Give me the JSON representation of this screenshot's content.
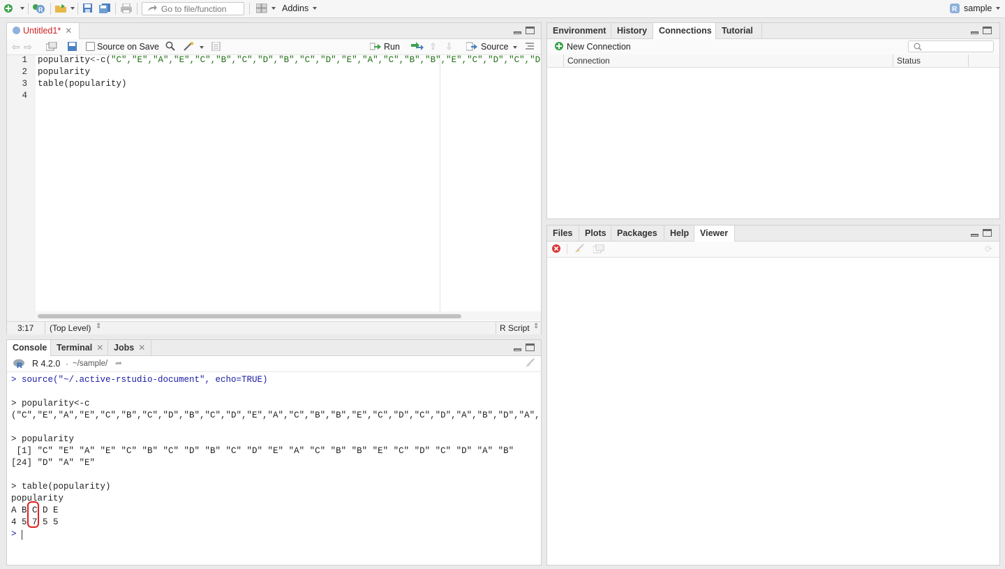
{
  "toolbar": {
    "goto_placeholder": "Go to file/function",
    "addins_label": "Addins",
    "project_label": "sample"
  },
  "source_pane": {
    "tab_label": "Untitled1*",
    "source_on_save_label": "Source on Save",
    "run_label": "Run",
    "source_label": "Source",
    "code_lines": [
      {
        "num": "1",
        "plain": "popularity",
        "op": "<-",
        "fn": "c(",
        "rest": "\"C\",\"E\",\"A\",\"E\",\"C\",\"B\",\"C\",\"D\",\"B\",\"C\",\"D\",\"E\",\"A\",\"C\",\"B\",\"B\",\"E\",\"C\",\"D\",\"C\",\"D\",\"A\""
      },
      {
        "num": "2",
        "plain": "popularity"
      },
      {
        "num": "3",
        "plain": "table(popularity)"
      },
      {
        "num": "4",
        "plain": ""
      }
    ],
    "status_position": "3:17",
    "status_scope": "(Top Level)",
    "status_type": "R Script"
  },
  "console_pane": {
    "tabs": [
      "Console",
      "Terminal",
      "Jobs"
    ],
    "r_version": "R 4.2.0",
    "path": "~/sample/",
    "lines": [
      {
        "text": "> source(\"~/.active-rstudio-document\", echo=TRUE)",
        "style": "blue"
      },
      {
        "text": "",
        "style": ""
      },
      {
        "text": "> popularity<-c",
        "style": ""
      },
      {
        "text": "(\"C\",\"E\",\"A\",\"E\",\"C\",\"B\",\"C\",\"D\",\"B\",\"C\",\"D\",\"E\",\"A\",\"C\",\"B\",\"B\",\"E\",\"C\",\"D\",\"C\",\"D\",\"A\",\"B\",\"D\",\"A\",\"E\")",
        "style": ""
      },
      {
        "text": "",
        "style": ""
      },
      {
        "text": "> popularity",
        "style": ""
      },
      {
        "text": " [1] \"C\" \"E\" \"A\" \"E\" \"C\" \"B\" \"C\" \"D\" \"B\" \"C\" \"D\" \"E\" \"A\" \"C\" \"B\" \"B\" \"E\" \"C\" \"D\" \"C\" \"D\" \"A\" \"B\"",
        "style": ""
      },
      {
        "text": "[24] \"D\" \"A\" \"E\"",
        "style": ""
      },
      {
        "text": "",
        "style": ""
      },
      {
        "text": "> table(popularity)",
        "style": ""
      },
      {
        "text": "popularity",
        "style": ""
      },
      {
        "text": "A B C D E",
        "style": ""
      },
      {
        "text": "4 5 7 5 5",
        "style": ""
      },
      {
        "text": ">",
        "style": "blue"
      }
    ]
  },
  "env_pane": {
    "tabs": [
      "Environment",
      "History",
      "Connections",
      "Tutorial"
    ],
    "active_tab": "Connections",
    "new_connection_label": "New Connection",
    "columns": [
      "Connection",
      "Status"
    ]
  },
  "files_pane": {
    "tabs": [
      "Files",
      "Plots",
      "Packages",
      "Help",
      "Viewer"
    ],
    "active_tab": "Viewer"
  },
  "colors": {
    "accent_red": "#e02020",
    "keyword_green": "#1e6e12",
    "console_blue": "#1a1aa6"
  }
}
